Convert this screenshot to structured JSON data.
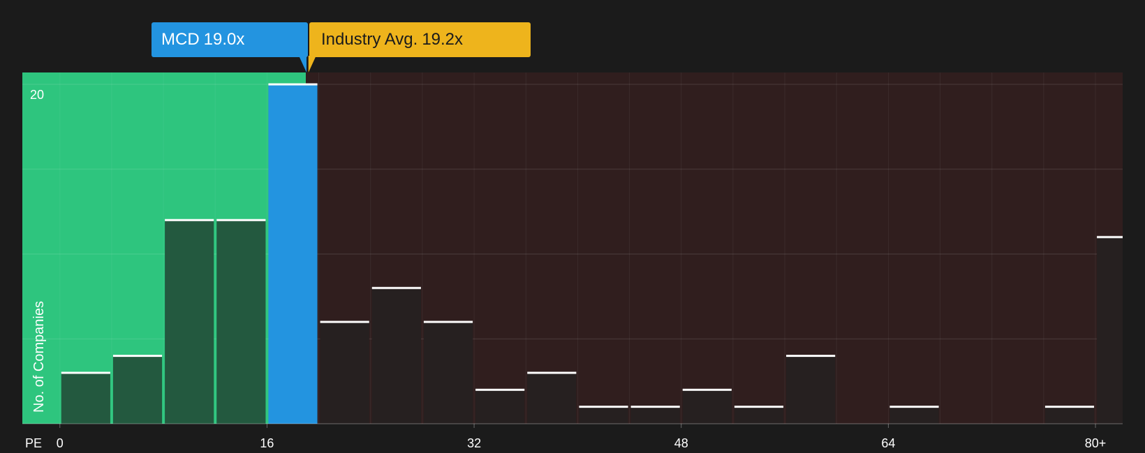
{
  "callouts": {
    "company_ticker": "MCD",
    "company_value": "19.0x",
    "industry_label": "Industry Avg.",
    "industry_value": "19.2x"
  },
  "colors": {
    "background": "#1b1b1b",
    "fair_zone": "#2ec57e",
    "over_zone": "#301e1e",
    "company_bar": "#2394e0",
    "industry_marker": "#eeb41c",
    "green_bar": "#23593f",
    "dark_bar": "#262020",
    "bar_top": "#ffffff"
  },
  "chart_data": {
    "type": "bar",
    "xlabel": "PE",
    "ylabel": "No. of Companies",
    "x_ticks": [
      "0",
      "16",
      "32",
      "48",
      "64",
      "80+"
    ],
    "x_tick_values": [
      0,
      16,
      32,
      48,
      64,
      80
    ],
    "y_ticks": [
      "20"
    ],
    "y_tick_values": [
      20
    ],
    "ylim": [
      0,
      20.7
    ],
    "xlim": [
      -2.9,
      82.1
    ],
    "bin_width": 4,
    "company_value": 19.0,
    "industry_value": 19.2,
    "bars": [
      {
        "x_start": 0,
        "value": 3
      },
      {
        "x_start": 4,
        "value": 4
      },
      {
        "x_start": 8,
        "value": 12
      },
      {
        "x_start": 12,
        "value": 12
      },
      {
        "x_start": 16,
        "value": 20,
        "highlight": true
      },
      {
        "x_start": 20,
        "value": 6
      },
      {
        "x_start": 24,
        "value": 8
      },
      {
        "x_start": 28,
        "value": 6
      },
      {
        "x_start": 32,
        "value": 2
      },
      {
        "x_start": 36,
        "value": 3
      },
      {
        "x_start": 40,
        "value": 1
      },
      {
        "x_start": 44,
        "value": 1
      },
      {
        "x_start": 48,
        "value": 2
      },
      {
        "x_start": 52,
        "value": 1
      },
      {
        "x_start": 56,
        "value": 4
      },
      {
        "x_start": 60,
        "value": 0
      },
      {
        "x_start": 64,
        "value": 1
      },
      {
        "x_start": 68,
        "value": 0
      },
      {
        "x_start": 72,
        "value": 0
      },
      {
        "x_start": 76,
        "value": 1
      },
      {
        "x_start": 80,
        "value": 11
      }
    ]
  }
}
